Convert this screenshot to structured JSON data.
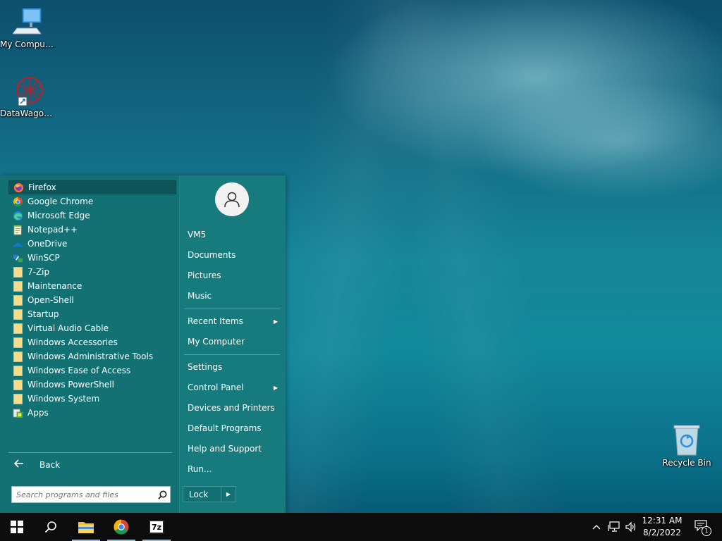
{
  "desktop": {
    "icons": [
      {
        "label": "My Computer",
        "icon": "computer-icon"
      },
      {
        "label": "DataWagon...",
        "icon": "datawagon-icon"
      },
      {
        "label": "Recycle Bin",
        "icon": "recycle-bin-icon"
      }
    ]
  },
  "start_menu": {
    "programs": [
      {
        "label": "Firefox",
        "icon": "firefox-icon"
      },
      {
        "label": "Google Chrome",
        "icon": "chrome-icon"
      },
      {
        "label": "Microsoft Edge",
        "icon": "edge-icon"
      },
      {
        "label": "Notepad++",
        "icon": "notepad-plus-plus-icon"
      },
      {
        "label": "OneDrive",
        "icon": "onedrive-icon"
      },
      {
        "label": "WinSCP",
        "icon": "winscp-icon"
      },
      {
        "label": "7-Zip",
        "icon": "folder-icon"
      },
      {
        "label": "Maintenance",
        "icon": "folder-icon"
      },
      {
        "label": "Open-Shell",
        "icon": "folder-icon"
      },
      {
        "label": "Startup",
        "icon": "folder-icon"
      },
      {
        "label": "Virtual Audio Cable",
        "icon": "folder-icon"
      },
      {
        "label": "Windows Accessories",
        "icon": "folder-icon"
      },
      {
        "label": "Windows Administrative Tools",
        "icon": "folder-icon"
      },
      {
        "label": "Windows Ease of Access",
        "icon": "folder-icon"
      },
      {
        "label": "Windows PowerShell",
        "icon": "folder-icon"
      },
      {
        "label": "Windows System",
        "icon": "folder-icon"
      },
      {
        "label": "Apps",
        "icon": "apps-icon"
      }
    ],
    "back_label": "Back",
    "search_placeholder": "Search programs and files",
    "right": {
      "user": "VM5",
      "documents": "Documents",
      "pictures": "Pictures",
      "music": "Music",
      "recent_items": "Recent Items",
      "my_computer": "My Computer",
      "settings": "Settings",
      "control_panel": "Control Panel",
      "devices_printers": "Devices and Printers",
      "default_programs": "Default Programs",
      "help_support": "Help and Support",
      "run": "Run...",
      "lock": "Lock"
    }
  },
  "taskbar": {
    "pinned": [
      {
        "name": "file-explorer",
        "icon": "folder-icon"
      },
      {
        "name": "chrome",
        "icon": "chrome-icon"
      },
      {
        "name": "7zip",
        "icon": "7zip-icon",
        "text": "7z"
      }
    ],
    "clock_time": "12:31 AM",
    "clock_date": "8/2/2022",
    "notification_count": "1"
  },
  "colors": {
    "menu_left": "#137174",
    "menu_right": "#177a7c",
    "taskbar": "#0c0c0c",
    "selected_item": "#0d5559"
  }
}
